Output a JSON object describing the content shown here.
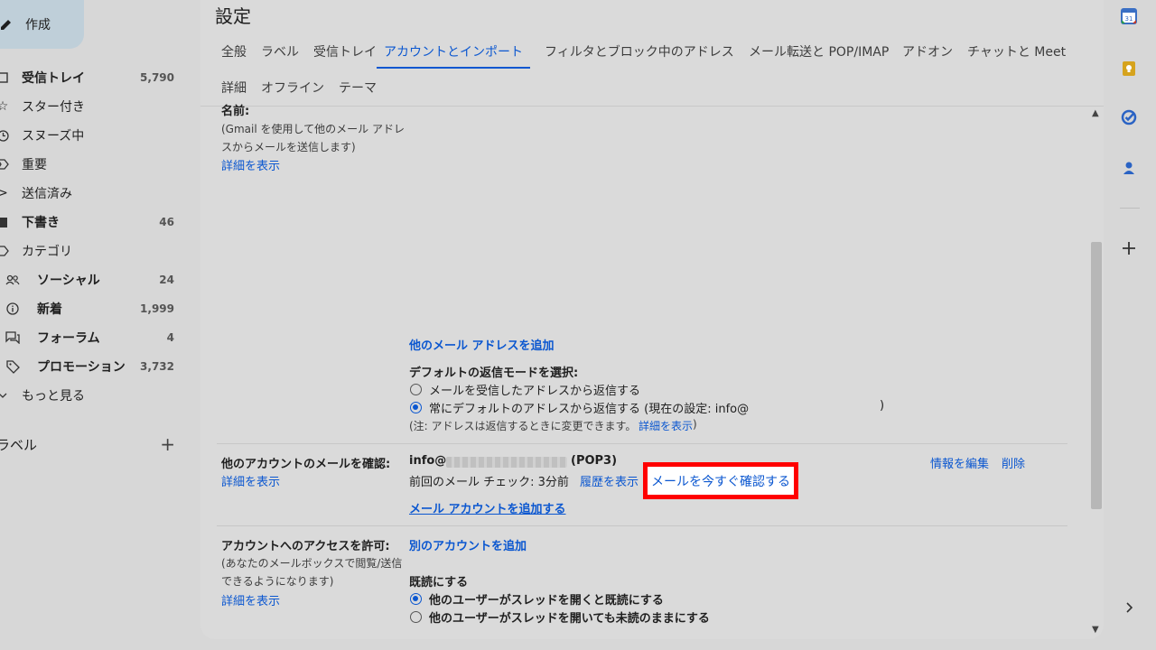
{
  "sidebar": {
    "compose_label": "作成",
    "items": [
      {
        "label": "受信トレイ",
        "count": "5,790"
      },
      {
        "label": "スター付き",
        "count": ""
      },
      {
        "label": "スヌーズ中",
        "count": ""
      },
      {
        "label": "重要",
        "count": ""
      },
      {
        "label": "送信済み",
        "count": ""
      },
      {
        "label": "下書き",
        "count": "46"
      },
      {
        "label": "カテゴリ",
        "count": ""
      },
      {
        "label": "ソーシャル",
        "count": "24"
      },
      {
        "label": "新着",
        "count": "1,999"
      },
      {
        "label": "フォーラム",
        "count": "4"
      },
      {
        "label": "プロモーション",
        "count": "3,732"
      },
      {
        "label": "もっと見る",
        "count": ""
      }
    ],
    "labels_header": "ラベル",
    "labels_add": "+"
  },
  "main": {
    "title": "設定",
    "tabs": [
      "全般",
      "ラベル",
      "受信トレイ",
      "アカウントとインポート",
      "フィルタとブロック中のアドレス",
      "メール転送と POP/IMAP",
      "アドオン",
      "チャットと Meet",
      "詳細",
      "オフライン",
      "テーマ"
    ],
    "active_tab": "アカウントとインポート",
    "name_section": {
      "label": "名前:",
      "desc1": "(Gmail を使用して他のメール アドレ",
      "desc2": "スからメールを送信します)",
      "details": "詳細を表示"
    },
    "add_address": "他のメール アドレスを追加",
    "reply_mode": {
      "heading": "デフォルトの返信モードを選択:",
      "option1": "メールを受信したアドレスから返信する",
      "option2_prefix": "常にデフォルトのアドレスから返信する (現在の設定: info@",
      "option2_suffix": ")",
      "note": "(注: アドレスは返信するときに変更できます。",
      "note_link": "詳細を表示",
      "note_end": ")"
    },
    "check_mail": {
      "label": "他のアカウントのメールを確認:",
      "details": "詳細を表示",
      "account_prefix": "info@",
      "account_suffix": "(POP3)",
      "last_check": "前回のメール チェック: 3分前",
      "history": "履歴を表示",
      "check_now": "メールを今すぐ確認する",
      "edit": "情報を編集",
      "delete": "削除",
      "add_account": "メール アカウントを追加する"
    },
    "grant_access": {
      "label": "アカウントへのアクセスを許可:",
      "desc1": "(あなたのメールボックスで閲覧/送信",
      "desc2": "できるようになります)",
      "details": "詳細を表示",
      "add_other": "別のアカウントを追加",
      "mark_read": "既読にする",
      "option1": "他のユーザーがスレッドを開くと既読にする",
      "option2": "他のユーザーがスレッドを開いても未読のままにする"
    }
  },
  "colors": {
    "link": "#0b57d0",
    "highlight_border": "#ff0000"
  }
}
